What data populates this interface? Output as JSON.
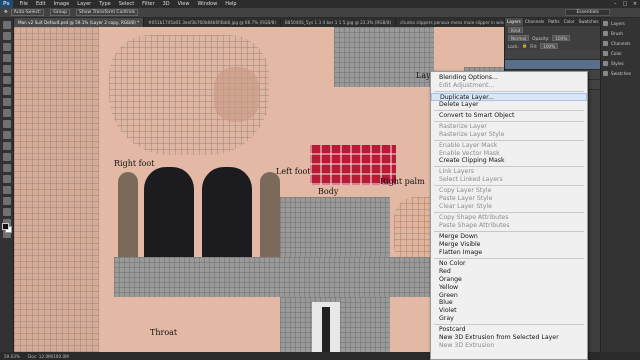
{
  "app": {
    "logo": "Ps"
  },
  "menubar": [
    "File",
    "Edit",
    "Image",
    "Layer",
    "Type",
    "Select",
    "Filter",
    "3D",
    "View",
    "Window",
    "Help"
  ],
  "options": {
    "auto_select": "Auto-Select:",
    "group": "Group",
    "show_transform": "Show Transform Controls",
    "workspace": "Essentials"
  },
  "tabs": [
    "Man v2 Suit Default.psd @ 59.1% (Layer 2 copy, RGB/8) *",
    "#051b1745a01 3eef3b760b84b6f4bb6.jpg @ 66.7% (RGB/8)",
    "B85040S_5ys 1 3 4 ber 1 1 5.jpg @ 23.3% (RGB/8)",
    "chunks slippers penoux mens mule slipper in wine leather 25 pl"
  ],
  "canvas": {
    "labels": {
      "right_foot": "Right foot",
      "left_foot": "Left foot",
      "body": "Body",
      "right_palm": "Right palm",
      "throat": "Throat",
      "top_fragment": "Lay"
    }
  },
  "status": {
    "zoom": "59.03%",
    "doc": "Doc: 12.0M/100.0M"
  },
  "layers_panel": {
    "tabs": [
      "Layers",
      "Channels",
      "Paths",
      "Color",
      "Swatches"
    ],
    "kind": "Kind",
    "mode": "Normal",
    "opacity_label": "Opacity:",
    "opacity": "100%",
    "lock_label": "Lock:",
    "fill_label": "Fill:",
    "fill": "100%"
  },
  "dock": [
    "Layers",
    "Brush",
    "Channels",
    "Color",
    "Styles",
    "Swatches"
  ],
  "context_menu": {
    "groups": [
      [
        {
          "t": "Blending Options..."
        },
        {
          "t": "Edit Adjustment...",
          "d": true
        }
      ],
      [
        {
          "t": "Duplicate Layer...",
          "h": true
        },
        {
          "t": "Delete Layer"
        }
      ],
      [
        {
          "t": "Convert to Smart Object"
        }
      ],
      [
        {
          "t": "Rasterize Layer",
          "d": true
        },
        {
          "t": "Rasterize Layer Style",
          "d": true
        }
      ],
      [
        {
          "t": "Enable Layer Mask",
          "d": true
        },
        {
          "t": "Enable Vector Mask",
          "d": true
        },
        {
          "t": "Create Clipping Mask"
        }
      ],
      [
        {
          "t": "Link Layers",
          "d": true
        },
        {
          "t": "Select Linked Layers",
          "d": true
        }
      ],
      [
        {
          "t": "Copy Layer Style",
          "d": true
        },
        {
          "t": "Paste Layer Style",
          "d": true
        },
        {
          "t": "Clear Layer Style",
          "d": true
        }
      ],
      [
        {
          "t": "Copy Shape Attributes",
          "d": true
        },
        {
          "t": "Paste Shape Attributes",
          "d": true
        }
      ],
      [
        {
          "t": "Merge Down"
        },
        {
          "t": "Merge Visible"
        },
        {
          "t": "Flatten Image"
        }
      ],
      [
        {
          "t": "No Color"
        },
        {
          "t": "Red"
        },
        {
          "t": "Orange"
        },
        {
          "t": "Yellow"
        },
        {
          "t": "Green"
        },
        {
          "t": "Blue"
        },
        {
          "t": "Violet"
        },
        {
          "t": "Gray"
        }
      ],
      [
        {
          "t": "Postcard"
        },
        {
          "t": "New 3D Extrusion from Selected Layer"
        },
        {
          "t": "New 3D Extrusion",
          "d": true
        }
      ]
    ]
  }
}
